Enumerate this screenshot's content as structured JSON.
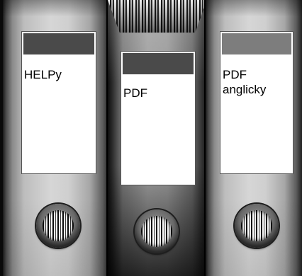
{
  "binders": [
    {
      "label_line1": "HELPy",
      "label_line2": ""
    },
    {
      "label_line1": "PDF",
      "label_line2": ""
    },
    {
      "label_line1": "PDF",
      "label_line2": "anglicky"
    }
  ],
  "colors": {
    "stripe_dark": "#4a4a4a",
    "stripe_light": "#7d7d7d",
    "background": "#0a0a0a"
  },
  "icons": {
    "ring": "binder-ring-icon"
  }
}
